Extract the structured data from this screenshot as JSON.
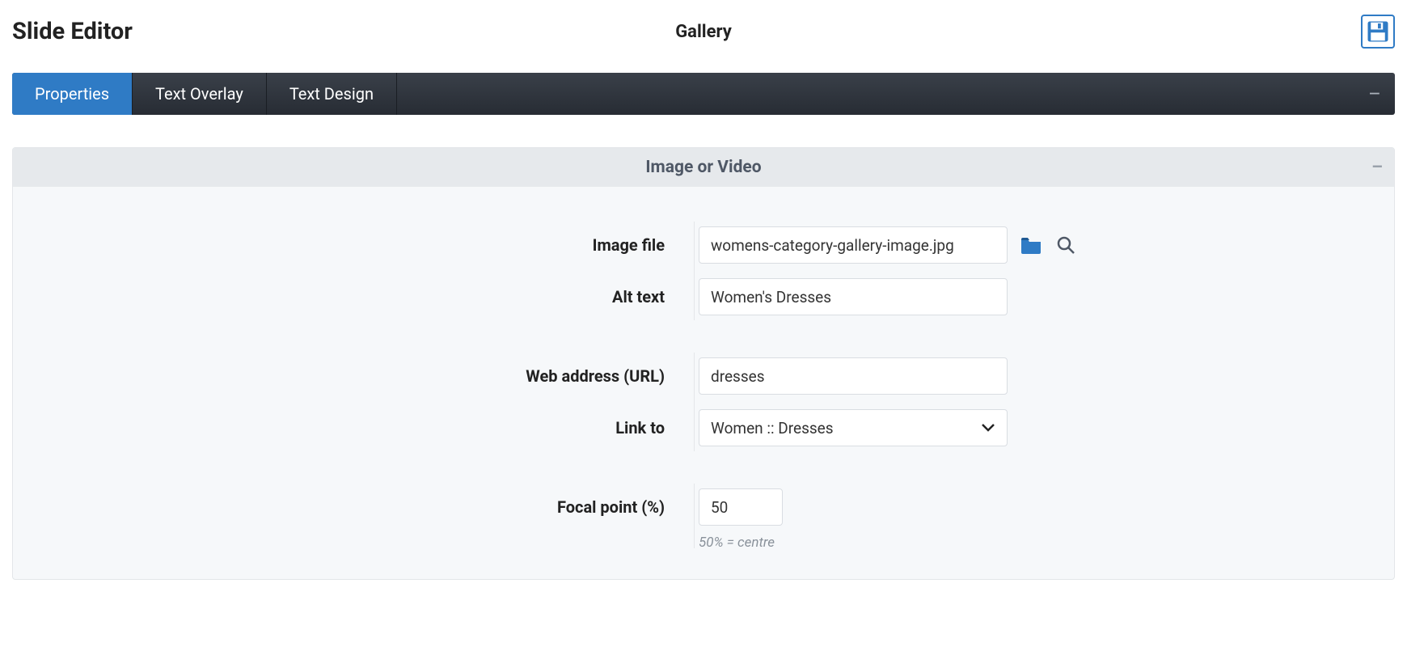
{
  "header": {
    "title": "Slide Editor",
    "subtitle": "Gallery"
  },
  "tabs": {
    "properties": "Properties",
    "text_overlay": "Text Overlay",
    "text_design": "Text Design"
  },
  "section": {
    "title": "Image or Video"
  },
  "labels": {
    "image_file": "Image file",
    "alt_text": "Alt text",
    "web_address": "Web address (URL)",
    "link_to": "Link to",
    "focal_point": "Focal point (%)"
  },
  "values": {
    "image_file": "womens-category-gallery-image.jpg",
    "alt_text": "Women's Dresses",
    "web_address": "dresses",
    "link_to": "Women :: Dresses",
    "focal_point": "50"
  },
  "hints": {
    "focal_point": "50% = centre"
  },
  "icons": {
    "collapse": "–"
  }
}
